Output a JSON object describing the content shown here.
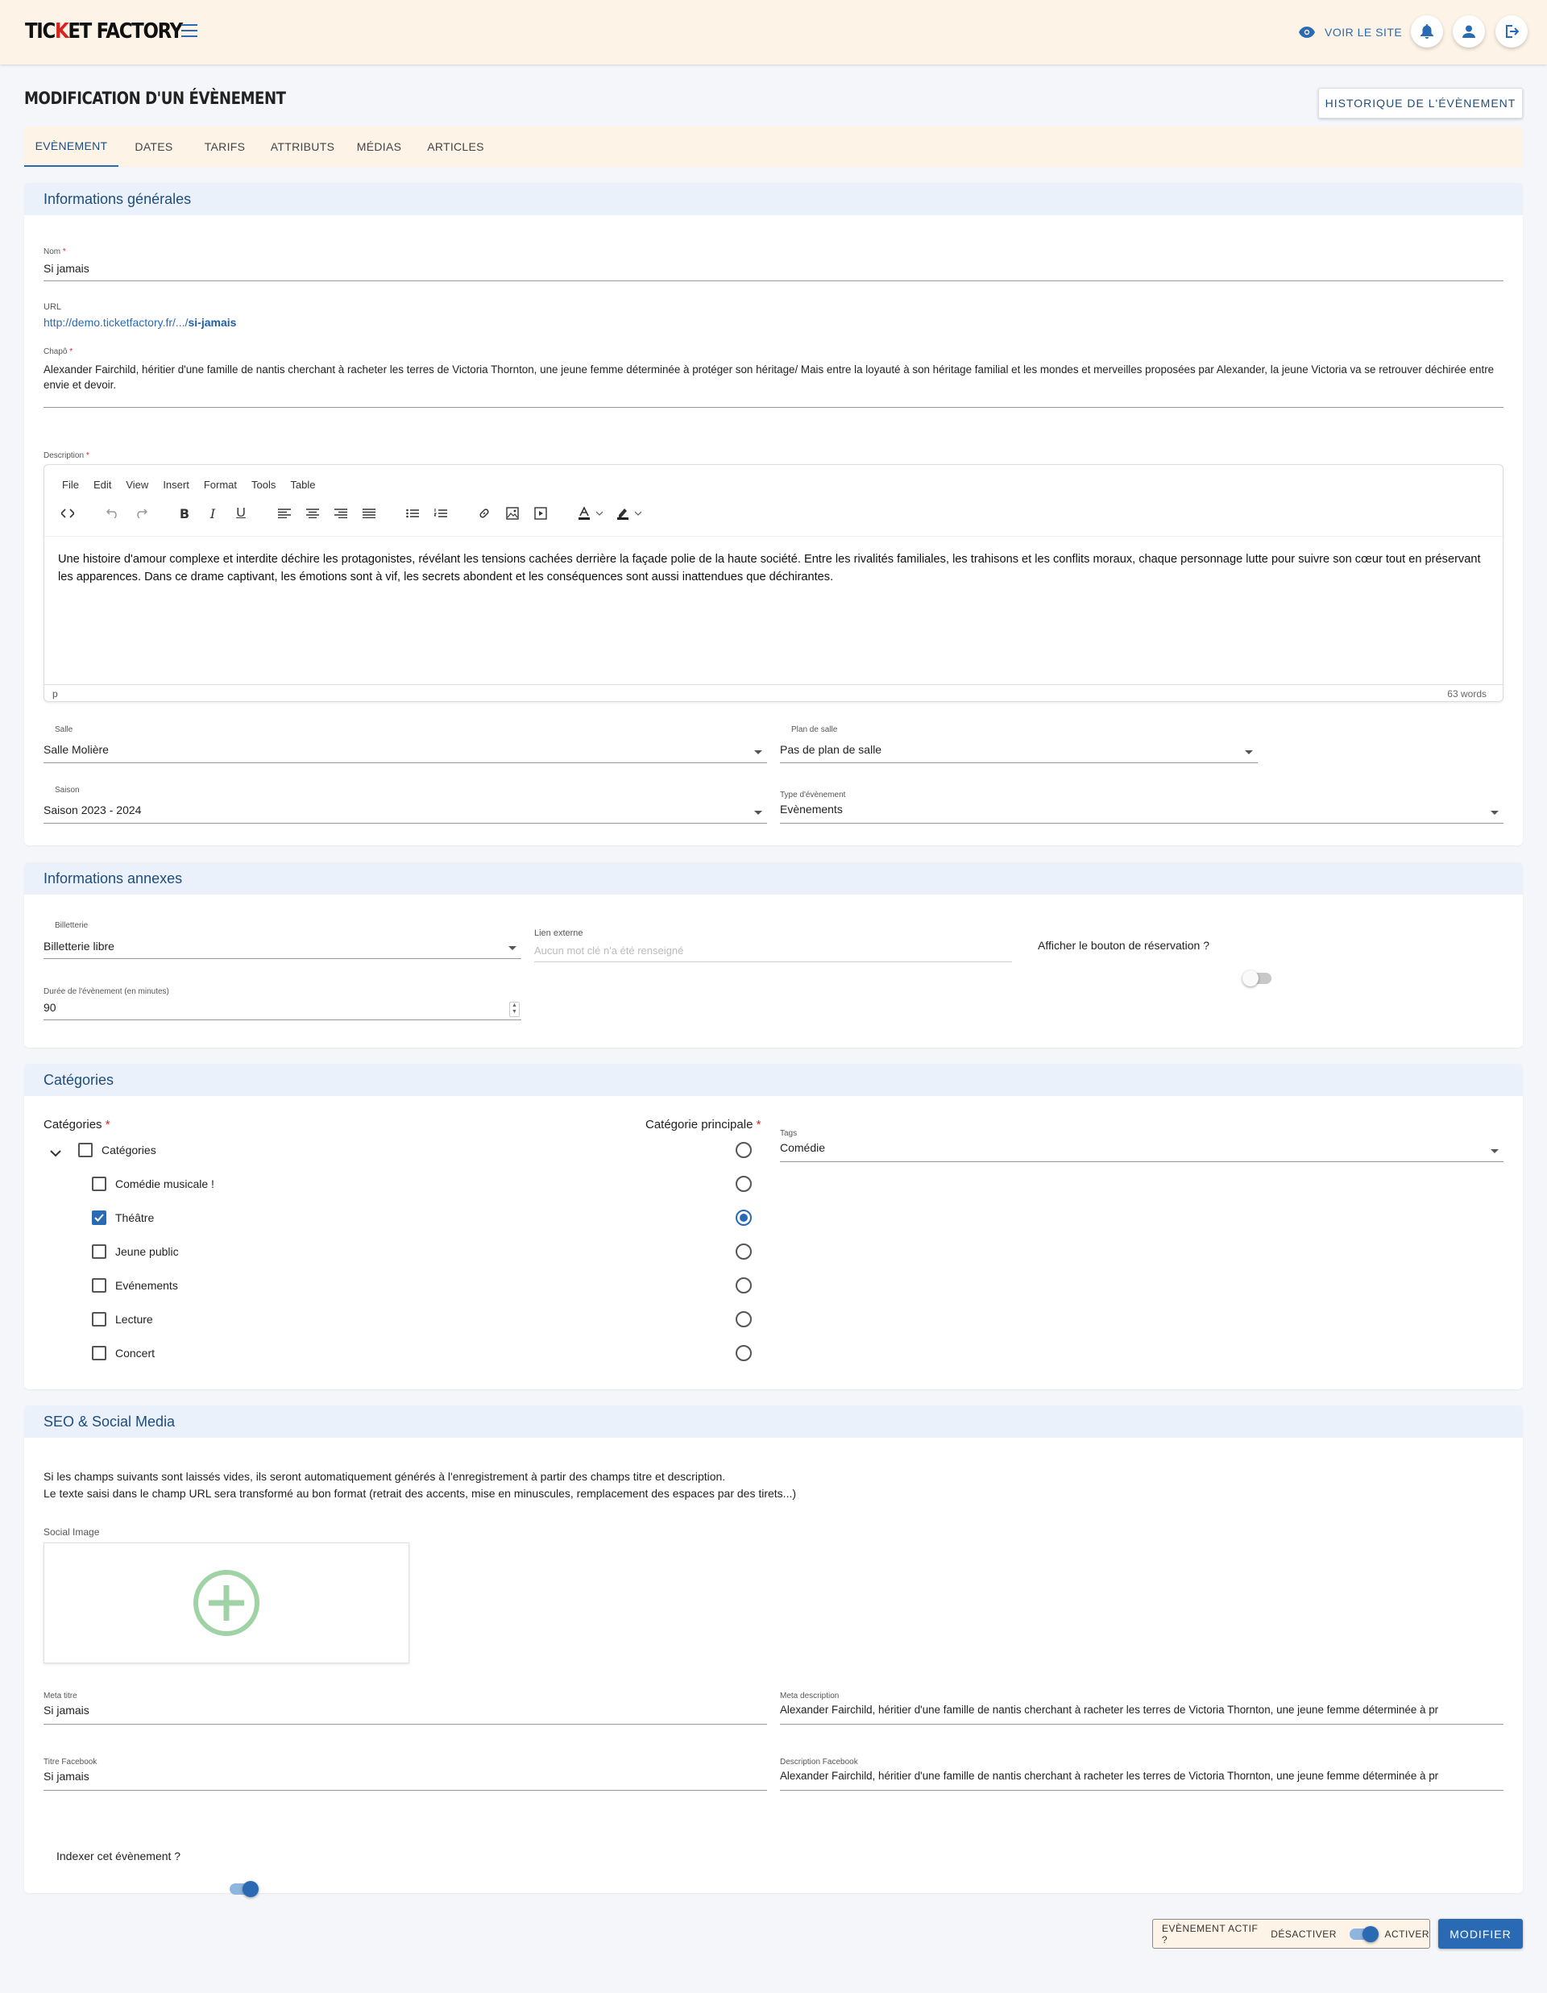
{
  "header": {
    "logo_pre": "TIC",
    "logo_red": "K",
    "logo_post": "ET FACTORY",
    "voir_site": "VOIR LE SITE"
  },
  "page": {
    "title": "MODIFICATION D'UN ÉVÈNEMENT",
    "history_button": "HISTORIQUE DE L'ÉVÈNEMENT"
  },
  "tabs": [
    {
      "label": "EVÈNEMENT"
    },
    {
      "label": "DATES"
    },
    {
      "label": "TARIFS"
    },
    {
      "label": "ATTRIBUTS"
    },
    {
      "label": "MÉDIAS"
    },
    {
      "label": "ARTICLES"
    }
  ],
  "general": {
    "title": "Informations générales",
    "nom_label": "Nom",
    "nom_value": "Si jamais",
    "url_label": "URL",
    "url_prefix": "http://demo.ticketfactory.fr/.../",
    "url_slug": "si-jamais",
    "chapo_label": "Chapô",
    "chapo_value": "Alexander Fairchild, héritier d'une famille de nantis cherchant à racheter les terres de Victoria Thornton, une jeune femme déterminée à protéger son héritage/ Mais entre la loyauté à son héritage familial et les mondes et merveilles proposées par Alexander, la jeune Victoria va se retrouver déchirée entre envie et devoir.",
    "description_label": "Description",
    "editor_menu": [
      "File",
      "Edit",
      "View",
      "Insert",
      "Format",
      "Tools",
      "Table"
    ],
    "description_text": "Une histoire d'amour complexe et interdite déchire les protagonistes, révélant les tensions cachées derrière la façade polie de la haute société. Entre les rivalités familiales, les trahisons et les conflits moraux, chaque personnage lutte pour suivre son cœur tout en préservant les apparences. Dans ce drame captivant, les émotions sont à vif, les secrets abondent et les conséquences sont aussi inattendues que déchirantes.",
    "editor_path": "p",
    "word_count": "63 words",
    "salle_label": "Salle",
    "salle_value": "Salle Molière",
    "plan_label": "Plan de salle",
    "plan_value": "Pas de plan de salle",
    "saison_label": "Saison",
    "saison_value": "Saison 2023 - 2024",
    "type_label": "Type d'évènement",
    "type_value": "Evènements"
  },
  "annexes": {
    "title": "Informations annexes",
    "billetterie_label": "Billetterie",
    "billetterie_value": "Billetterie libre",
    "lien_label": "Lien externe",
    "lien_placeholder": "Aucun mot clé n'a été renseigné",
    "reservation_label": "Afficher le bouton de réservation ?",
    "duree_label": "Durée de l'évènement (en minutes)",
    "duree_value": "90"
  },
  "categories": {
    "title": "Catégories",
    "cat_label": "Catégories",
    "main_label": "Catégorie principale",
    "root_label": "Catégories",
    "items": [
      {
        "label": "Comédie musicale !",
        "checked": false,
        "main": false
      },
      {
        "label": "Théâtre",
        "checked": true,
        "main": true
      },
      {
        "label": "Jeune public",
        "checked": false,
        "main": false
      },
      {
        "label": "Evénements",
        "checked": false,
        "main": false
      },
      {
        "label": "Lecture",
        "checked": false,
        "main": false
      },
      {
        "label": "Concert",
        "checked": false,
        "main": false
      }
    ],
    "tags_label": "Tags",
    "tags_value": "Comédie"
  },
  "seo": {
    "title": "SEO & Social Media",
    "info_line1": "Si les champs suivants sont laissés vides, ils seront automatiquement générés à l'enregistrement à partir des champs titre et description.",
    "info_line2": "Le texte saisi dans le champ URL sera transformé au bon format (retrait des accents, mise en minuscules, remplacement des espaces par des tirets...)",
    "social_label": "Social Image",
    "meta_titre_label": "Meta titre",
    "meta_titre_value": "Si jamais",
    "meta_desc_label": "Meta description",
    "meta_desc_value": "Alexander Fairchild, héritier d'une famille de nantis cherchant à racheter les terres de Victoria Thornton, une jeune femme déterminée à pr",
    "fb_titre_label": "Titre Facebook",
    "fb_titre_value": "Si jamais",
    "fb_desc_label": "Description Facebook",
    "fb_desc_value": "Alexander Fairchild, héritier d'une famille de nantis cherchant à racheter les terres de Victoria Thornton, une jeune femme déterminée à pr",
    "index_label": "Indexer cet évènement ?"
  },
  "footer": {
    "actif_label": "EVÈNEMENT ACTIF ?",
    "desactiver": "DÉSACTIVER",
    "activer": "ACTIVER",
    "modifier": "MODIFIER"
  },
  "colors": {
    "accent": "#2a6ab5",
    "header_bg": "#fdf3e6",
    "brand_red": "#d9231e",
    "add_green": "#9fd3a6"
  }
}
